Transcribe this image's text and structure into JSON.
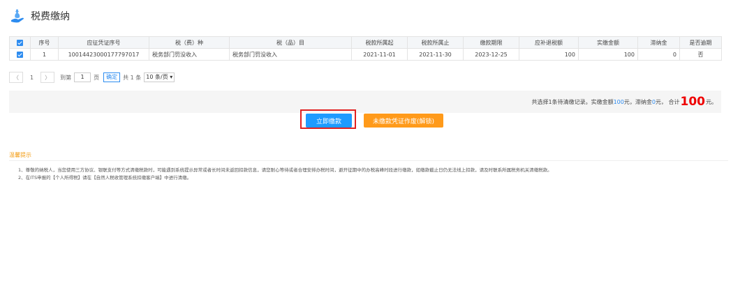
{
  "header": {
    "title": "税费缴纳"
  },
  "table": {
    "columns": [
      "序号",
      "应征凭证序号",
      "税（费）种",
      "税（品）目",
      "税款所属起",
      "税款所属止",
      "缴款期限",
      "应补退税额",
      "实缴金额",
      "滞纳金",
      "是否逾期"
    ],
    "rows": [
      {
        "seq": "1",
        "voucher": "10014423000177797017",
        "tax_type": "税务部门罚没收入",
        "tax_item": "税务部门罚没收入",
        "period_start": "2021-11-01",
        "period_end": "2021-11-30",
        "deadline": "2023-12-25",
        "amount_due": "100",
        "amount_paid": "100",
        "late_fee": "0",
        "overdue": "否"
      }
    ]
  },
  "pager": {
    "prev": "〈",
    "page": "1",
    "next": "〉",
    "goto_label": "到第",
    "goto_value": "1",
    "page_unit": "页",
    "confirm": "确定",
    "total": "共 1 条",
    "page_size": "10 条/页 ▾"
  },
  "summary": {
    "prefix": "共选择1条待清缴记录。实缴金额",
    "paid": "100",
    "mid1": " 元，滞纳金 ",
    "late": "0",
    "mid2": "元，  合计",
    "total": "100",
    "suffix": "元。"
  },
  "buttons": {
    "pay": "立即缴款",
    "void": "未缴款凭证作废(解锁)"
  },
  "tips": {
    "title": "温馨提示",
    "items": [
      "1、尊敬的纳税人，当您使用三方协议、银联支付等方式清缴税款时，可能遇到系统提示异常或者长时间未返回扣款信息，请您耐心等待或者合理安排办税时间，避开征期中的办税高峰时段进行缴款，如缴款截止日仍无法线上扣款，请及时联系所属税务机关清缴税款。",
      "2、在ITS申报的【个人所得税】请在【自然人税收管理系统扣缴客户端】中进行清缴。"
    ]
  },
  "colors": {
    "accent": "#2d8cf0",
    "pay_button": "#1e9bff",
    "void_button": "#ff9a1a",
    "highlight_box": "#e02020",
    "total_red": "#e00000"
  }
}
